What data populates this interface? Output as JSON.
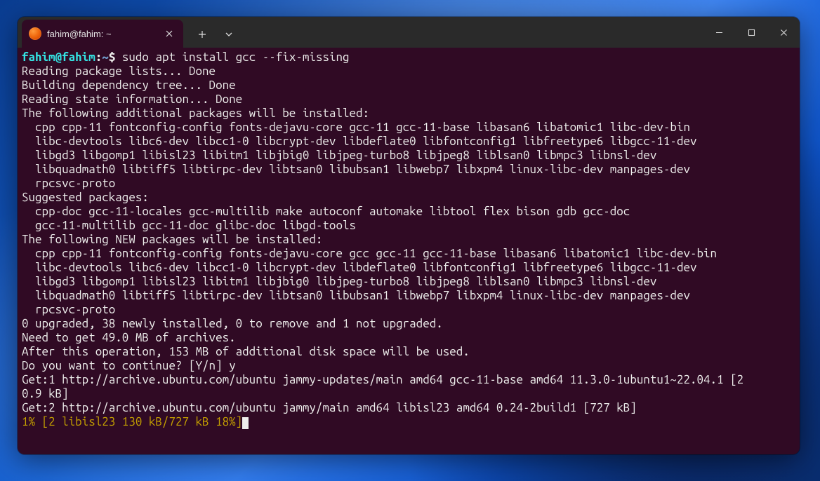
{
  "colors": {
    "terminal_bg": "#300a24",
    "titlebar_bg": "#2a2a2a",
    "prompt_user": "#34e2e2",
    "prompt_path": "#729fcf",
    "progress": "#c4a000",
    "text": "#eeeeec"
  },
  "titlebar": {
    "tab_title": "fahim@fahim: ~",
    "icons": {
      "close_tab": "close-icon",
      "new_tab": "plus-icon",
      "tab_menu": "chevron-down-icon",
      "minimize": "minimize-icon",
      "maximize": "maximize-icon",
      "close_window": "close-icon"
    }
  },
  "prompt": {
    "user_host": "fahim@fahim",
    "colon": ":",
    "path": "~",
    "symbol": "$",
    "command": "sudo apt install gcc --fix-missing"
  },
  "output": {
    "l1": "Reading package lists... Done",
    "l2": "Building dependency tree... Done",
    "l3": "Reading state information... Done",
    "l4": "The following additional packages will be installed:",
    "l5": "  cpp cpp-11 fontconfig-config fonts-dejavu-core gcc-11 gcc-11-base libasan6 libatomic1 libc-dev-bin",
    "l6": "  libc-devtools libc6-dev libcc1-0 libcrypt-dev libdeflate0 libfontconfig1 libfreetype6 libgcc-11-dev",
    "l7": "  libgd3 libgomp1 libisl23 libitm1 libjbig0 libjpeg-turbo8 libjpeg8 liblsan0 libmpc3 libnsl-dev",
    "l8": "  libquadmath0 libtiff5 libtirpc-dev libtsan0 libubsan1 libwebp7 libxpm4 linux-libc-dev manpages-dev",
    "l9": "  rpcsvc-proto",
    "l10": "Suggested packages:",
    "l11": "  cpp-doc gcc-11-locales gcc-multilib make autoconf automake libtool flex bison gdb gcc-doc",
    "l12": "  gcc-11-multilib gcc-11-doc glibc-doc libgd-tools",
    "l13": "The following NEW packages will be installed:",
    "l14": "  cpp cpp-11 fontconfig-config fonts-dejavu-core gcc gcc-11 gcc-11-base libasan6 libatomic1 libc-dev-bin",
    "l15": "  libc-devtools libc6-dev libcc1-0 libcrypt-dev libdeflate0 libfontconfig1 libfreetype6 libgcc-11-dev",
    "l16": "  libgd3 libgomp1 libisl23 libitm1 libjbig0 libjpeg-turbo8 libjpeg8 liblsan0 libmpc3 libnsl-dev",
    "l17": "  libquadmath0 libtiff5 libtirpc-dev libtsan0 libubsan1 libwebp7 libxpm4 linux-libc-dev manpages-dev",
    "l18": "  rpcsvc-proto",
    "l19": "0 upgraded, 38 newly installed, 0 to remove and 1 not upgraded.",
    "l20": "Need to get 49.0 MB of archives.",
    "l21": "After this operation, 153 MB of additional disk space will be used.",
    "l22": "Do you want to continue? [Y/n] y",
    "l23": "Get:1 http://archive.ubuntu.com/ubuntu jammy-updates/main amd64 gcc-11-base amd64 11.3.0-1ubuntu1~22.04.1 [2",
    "l24": "0.9 kB]",
    "l25": "Get:2 http://archive.ubuntu.com/ubuntu jammy/main amd64 libisl23 amd64 0.24-2build1 [727 kB]"
  },
  "progress": {
    "line": "1% [2 libisl23 130 kB/727 kB 18%]"
  }
}
